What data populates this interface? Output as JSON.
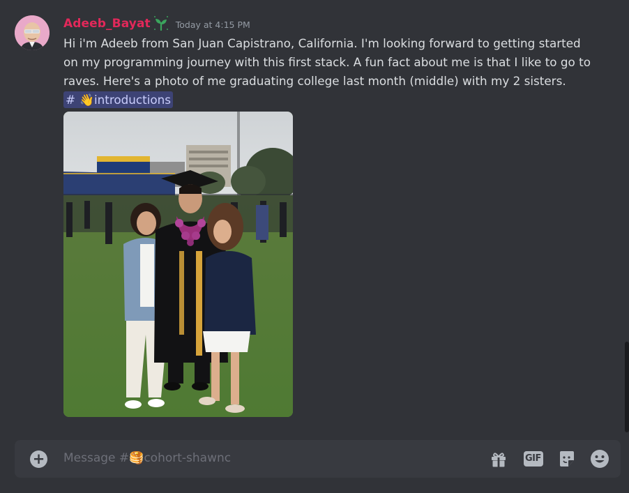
{
  "message": {
    "author": "Adeeb_Bayat",
    "timestamp": "Today at 4:15 PM",
    "role_icon": "sprout-icon",
    "avatar": "user-avatar",
    "text": "Hi i'm Adeeb from San Juan Capistrano, California. I'm looking forward to getting started on my programming journey with this first stack. A fun fact about me is that I like to go to raves. Here's a photo of me graduating college last month (middle) with my 2 sisters.",
    "channel_mention": {
      "hash": "#",
      "emoji": "👋",
      "name": "introductions"
    },
    "attachment": "graduation-photo"
  },
  "composer": {
    "placeholder_prefix": "Message #",
    "channel_emoji": "🥞",
    "channel_name": "cohort-shawnc",
    "tools": [
      "gift-icon",
      "gif-icon",
      "sticker-icon",
      "emoji-icon"
    ],
    "gif_label": "GIF"
  },
  "colors": {
    "background": "#313338",
    "composer_bg": "#383a40",
    "username": "#e2285a",
    "text": "#dbdee1",
    "muted": "#949ba4",
    "mention_bg": "#3c4270",
    "mention_text": "#c9cdfb"
  }
}
